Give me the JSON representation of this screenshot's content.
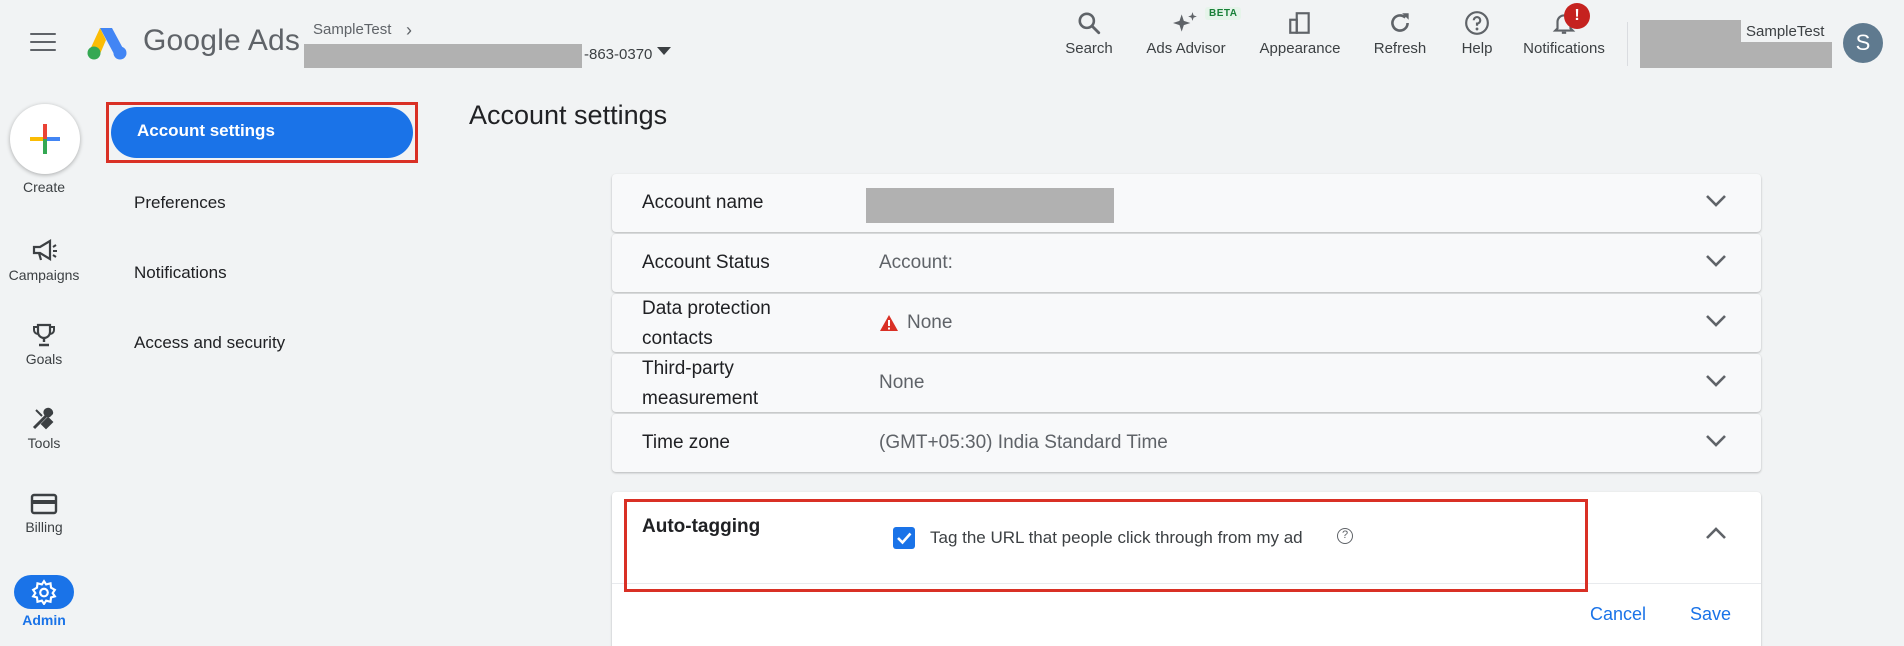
{
  "header": {
    "brand": "Google Ads",
    "breadcrumb": "SampleTest",
    "account_id_suffix": "-863-0370",
    "tools": [
      {
        "label": "Search",
        "icon": "search-icon"
      },
      {
        "label": "Ads Advisor",
        "icon": "sparkle-icon",
        "badge": "BETA"
      },
      {
        "label": "Appearance",
        "icon": "appearance-icon"
      },
      {
        "label": "Refresh",
        "icon": "refresh-icon"
      },
      {
        "label": "Help",
        "icon": "help-icon"
      },
      {
        "label": "Notifications",
        "icon": "bell-icon",
        "alert": "!"
      }
    ],
    "user_name": "SampleTest",
    "avatar_letter": "S"
  },
  "rail": {
    "create": "Create",
    "items": [
      {
        "label": "Campaigns",
        "icon": "megaphone-icon"
      },
      {
        "label": "Goals",
        "icon": "trophy-icon"
      },
      {
        "label": "Tools",
        "icon": "tools-icon"
      },
      {
        "label": "Billing",
        "icon": "credit-card-icon"
      },
      {
        "label": "Admin",
        "icon": "gear-icon"
      }
    ]
  },
  "settings_nav": {
    "active": "Account settings",
    "items": [
      "Preferences",
      "Notifications",
      "Access and security"
    ]
  },
  "main": {
    "title": "Account settings",
    "rows": [
      {
        "label": "Account name",
        "value": ""
      },
      {
        "label": "Account Status",
        "value": "Account:"
      },
      {
        "label_line1": "Data protection",
        "label_line2": "contacts",
        "value": "None"
      },
      {
        "label_line1": "Third-party",
        "label_line2": "measurement",
        "value": "None"
      },
      {
        "label": "Time zone",
        "value": "(GMT+05:30) India Standard Time"
      }
    ],
    "auto_tagging": {
      "title": "Auto-tagging",
      "checkbox_label": "Tag the URL that people click through from my ad",
      "checked": true,
      "cancel": "Cancel",
      "save": "Save"
    }
  },
  "colors": {
    "accent": "#1a73e8",
    "highlight_border": "#d93025",
    "warning": "#d93025"
  }
}
